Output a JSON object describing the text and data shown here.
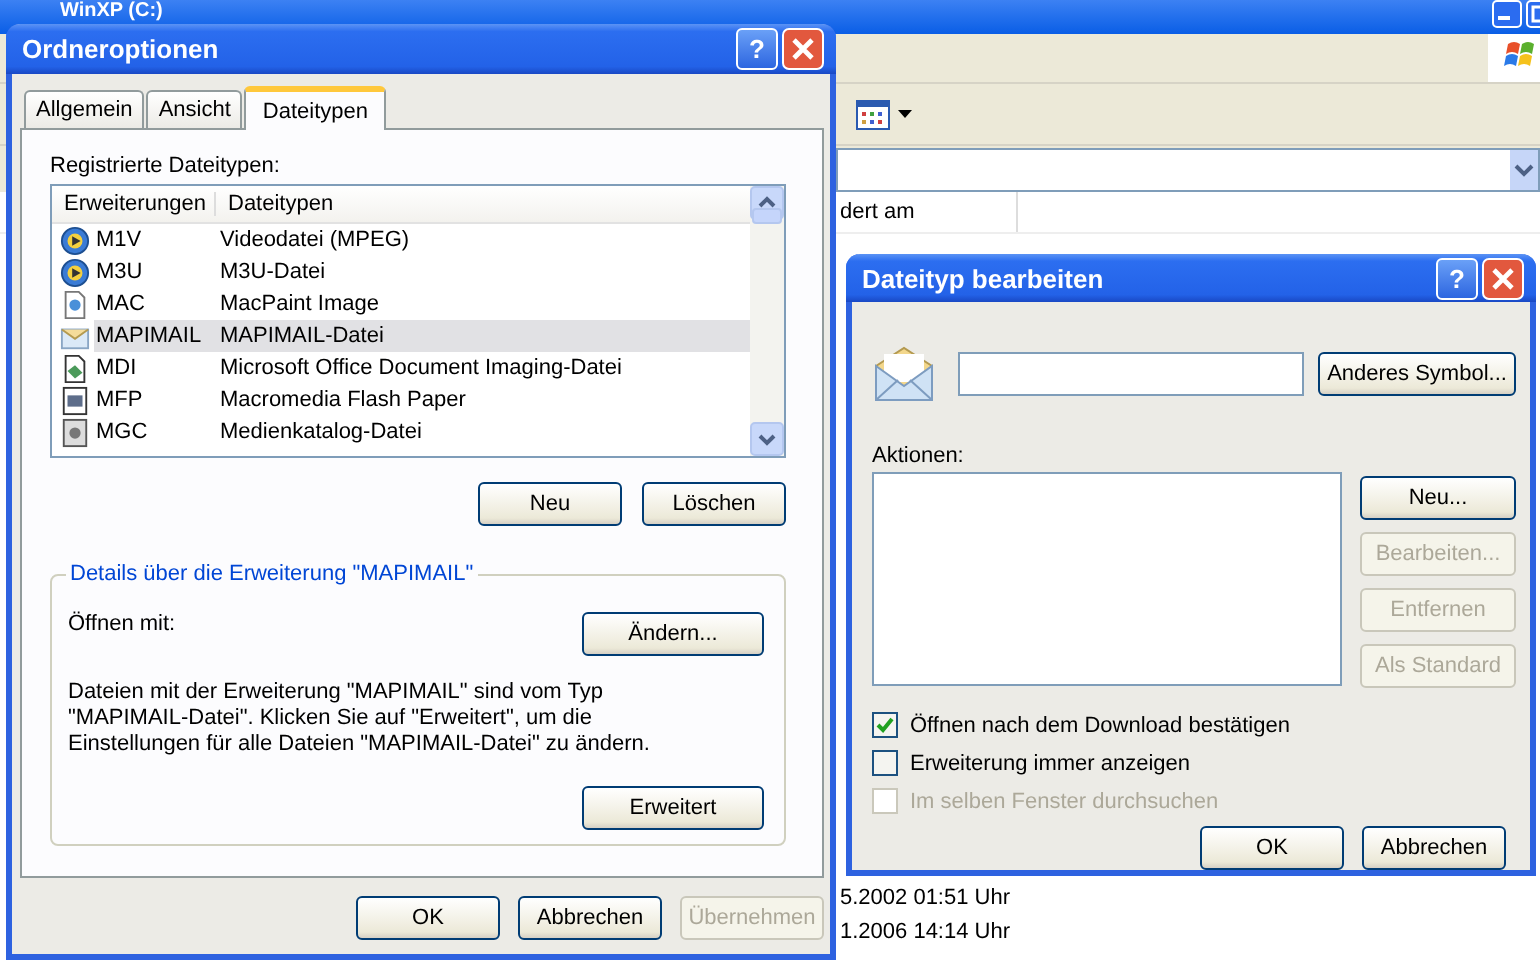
{
  "explorer": {
    "title": "WinXP (C:)",
    "column_header": "dert am",
    "rows": [
      "5.2002 01:51 Uhr",
      "1.2006 14:14 Uhr"
    ]
  },
  "folder_options": {
    "title": "Ordneroptionen",
    "help": "?",
    "tabs": [
      {
        "label": "Allgemein",
        "selected": false
      },
      {
        "label": "Ansicht",
        "selected": false
      },
      {
        "label": "Dateitypen",
        "selected": true
      }
    ],
    "list_label": "Registrierte Dateitypen:",
    "columns": [
      "Erweiterungen",
      "Dateitypen"
    ],
    "rows": [
      {
        "kind": "media",
        "extension": "M1V",
        "type": "Videodatei (MPEG)",
        "selected": false
      },
      {
        "kind": "media",
        "extension": "M3U",
        "type": "M3U-Datei",
        "selected": false
      },
      {
        "kind": "image",
        "extension": "MAC",
        "type": "MacPaint Image",
        "selected": false
      },
      {
        "kind": "mail",
        "extension": "MAPIMAIL",
        "type": "MAPIMAIL-Datei",
        "selected": true
      },
      {
        "kind": "document",
        "extension": "MDI",
        "type": "Microsoft Office Document Imaging-Datei",
        "selected": false
      },
      {
        "kind": "flash",
        "extension": "MFP",
        "type": "Macromedia Flash Paper",
        "selected": false
      },
      {
        "kind": "catalog",
        "extension": "MGC",
        "type": "Medienkatalog-Datei",
        "selected": false
      }
    ],
    "list_buttons": [
      "Neu",
      "Löschen"
    ],
    "details": {
      "legend": "Details über die Erweiterung \"MAPIMAIL\"",
      "open_with": "Öffnen mit:",
      "change_button": "Ändern...",
      "description": "Dateien mit der Erweiterung \"MAPIMAIL\" sind vom Typ \"MAPIMAIL-Datei\". Klicken Sie auf \"Erweitert\", um die Einstellungen für alle Dateien \"MAPIMAIL-Datei\" zu ändern.",
      "advanced_button": "Erweitert"
    },
    "footer_buttons": [
      {
        "label": "OK",
        "disabled": false
      },
      {
        "label": "Abbrechen",
        "disabled": false
      },
      {
        "label": "Übernehmen",
        "disabled": true
      }
    ]
  },
  "edit_type": {
    "title": "Dateityp bearbeiten",
    "help": "?",
    "icon_button": "Anderes Symbol...",
    "actions_label": "Aktionen:",
    "action_buttons": [
      {
        "label": "Neu...",
        "disabled": false
      },
      {
        "label": "Bearbeiten...",
        "disabled": true
      },
      {
        "label": "Entfernen",
        "disabled": true
      },
      {
        "label": "Als Standard",
        "disabled": true
      }
    ],
    "checkboxes": [
      {
        "label": "Öffnen nach dem Download bestätigen",
        "checked": true,
        "disabled": false
      },
      {
        "label": "Erweiterung immer anzeigen",
        "checked": false,
        "disabled": false
      },
      {
        "label": "Im selben Fenster durchsuchen",
        "checked": false,
        "disabled": true
      }
    ],
    "footer_buttons": [
      {
        "label": "OK",
        "disabled": false
      },
      {
        "label": "Abbrechen",
        "disabled": false
      }
    ]
  }
}
